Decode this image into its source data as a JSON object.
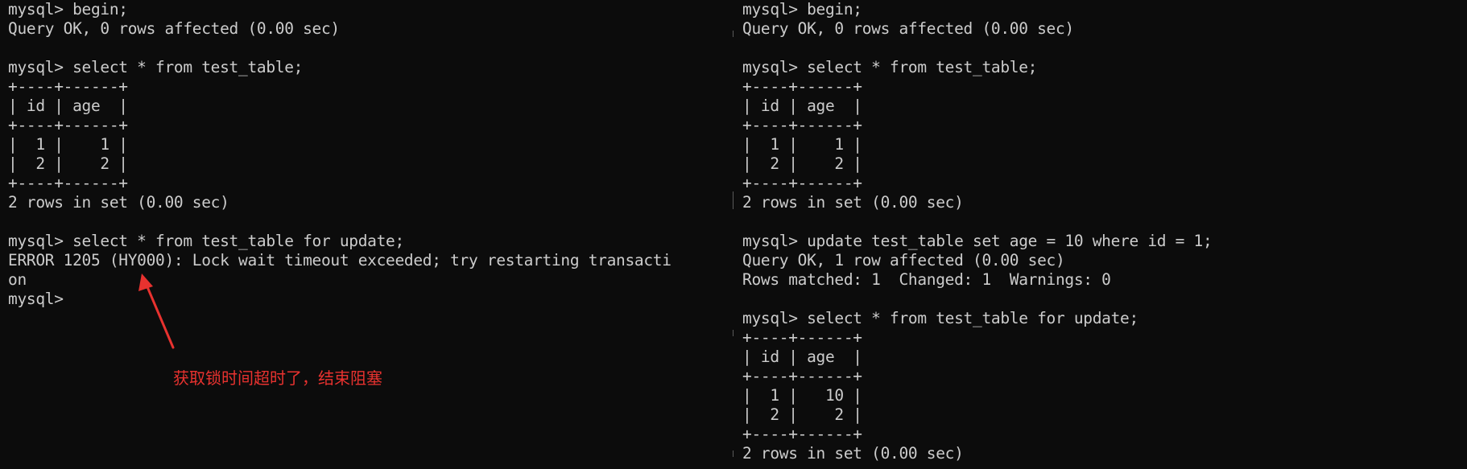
{
  "left_pane": {
    "lines": [
      "mysql> begin;",
      "Query OK, 0 rows affected (0.00 sec)",
      "",
      "mysql> select * from test_table;",
      "+----+------+",
      "| id | age  |",
      "+----+------+",
      "|  1 |    1 |",
      "|  2 |    2 |",
      "+----+------+",
      "2 rows in set (0.00 sec)",
      "",
      "mysql> select * from test_table for update;",
      "ERROR 1205 (HY000): Lock wait timeout exceeded; try restarting transacti",
      "on",
      "mysql> "
    ]
  },
  "right_pane": {
    "lines": [
      "mysql> begin;",
      "Query OK, 0 rows affected (0.00 sec)",
      "",
      "mysql> select * from test_table;",
      "+----+------+",
      "| id | age  |",
      "+----+------+",
      "|  1 |    1 |",
      "|  2 |    2 |",
      "+----+------+",
      "2 rows in set (0.00 sec)",
      "",
      "mysql> update test_table set age = 10 where id = 1;",
      "Query OK, 1 row affected (0.00 sec)",
      "Rows matched: 1  Changed: 1  Warnings: 0",
      "",
      "mysql> select * from test_table for update;",
      "+----+------+",
      "| id | age  |",
      "+----+------+",
      "|  1 |   10 |",
      "|  2 |    2 |",
      "+----+------+",
      "2 rows in set (0.00 sec)"
    ]
  },
  "annotation": {
    "text": "获取锁时间超时了，结束阻塞",
    "color": "#e8322f"
  },
  "colors": {
    "background": "#0c0c0c",
    "foreground": "#cccccc"
  }
}
